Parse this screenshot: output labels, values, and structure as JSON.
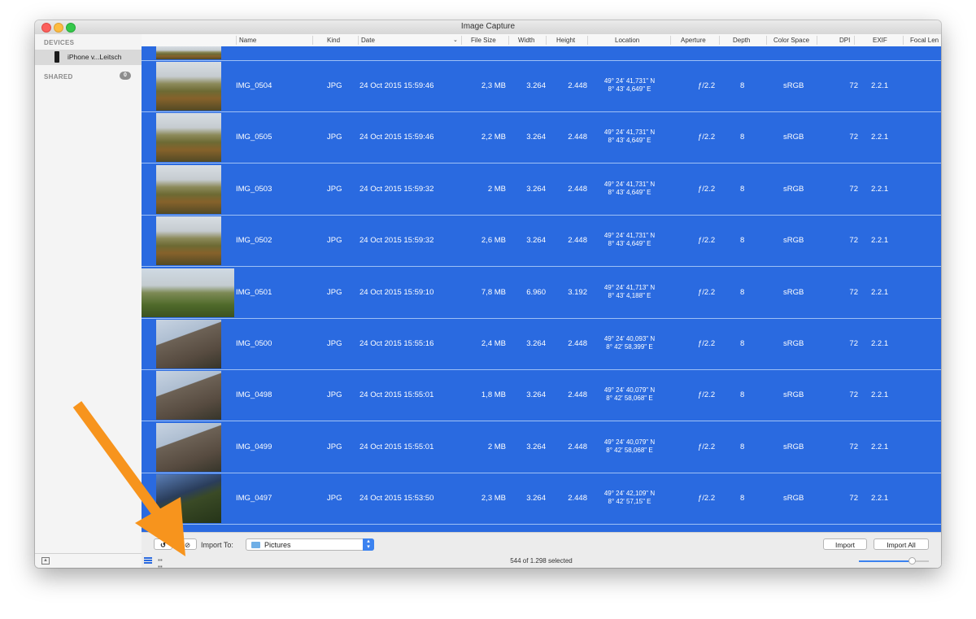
{
  "window": {
    "title": "Image Capture"
  },
  "sidebar": {
    "devices_header": "DEVICES",
    "device_label": "iPhone v...Leitsch",
    "shared_header": "SHARED",
    "shared_count": "0"
  },
  "columns": [
    "Name",
    "Kind",
    "Date",
    "File Size",
    "Width",
    "Height",
    "Location",
    "Aperture",
    "Depth",
    "Color Space",
    "DPI",
    "EXIF",
    "Focal Len"
  ],
  "rows": [
    {
      "name": "IMG_0504",
      "kind": "JPG",
      "date": "24 Oct 2015 15:59:46",
      "size": "2,3 MB",
      "width": "3.264",
      "height": "2.448",
      "loc1": "49° 24' 41,731\" N",
      "loc2": "8° 43' 4,649\" E",
      "aperture": "ƒ/2.2",
      "depth": "8",
      "colorspace": "sRGB",
      "dpi": "72",
      "exif": "2.2.1",
      "thumb": "town"
    },
    {
      "name": "IMG_0505",
      "kind": "JPG",
      "date": "24 Oct 2015 15:59:46",
      "size": "2,2 MB",
      "width": "3.264",
      "height": "2.448",
      "loc1": "49° 24' 41,731\" N",
      "loc2": "8° 43' 4,649\" E",
      "aperture": "ƒ/2.2",
      "depth": "8",
      "colorspace": "sRGB",
      "dpi": "72",
      "exif": "2.2.1",
      "thumb": "town"
    },
    {
      "name": "IMG_0503",
      "kind": "JPG",
      "date": "24 Oct 2015 15:59:32",
      "size": "2 MB",
      "width": "3.264",
      "height": "2.448",
      "loc1": "49° 24' 41,731\" N",
      "loc2": "8° 43' 4,649\" E",
      "aperture": "ƒ/2.2",
      "depth": "8",
      "colorspace": "sRGB",
      "dpi": "72",
      "exif": "2.2.1",
      "thumb": "town"
    },
    {
      "name": "IMG_0502",
      "kind": "JPG",
      "date": "24 Oct 2015 15:59:32",
      "size": "2,6 MB",
      "width": "3.264",
      "height": "2.448",
      "loc1": "49° 24' 41,731\" N",
      "loc2": "8° 43' 4,649\" E",
      "aperture": "ƒ/2.2",
      "depth": "8",
      "colorspace": "sRGB",
      "dpi": "72",
      "exif": "2.2.1",
      "thumb": "town"
    },
    {
      "name": "IMG_0501",
      "kind": "JPG",
      "date": "24 Oct 2015 15:59:10",
      "size": "7,8 MB",
      "width": "6.960",
      "height": "3.192",
      "loc1": "49° 24' 41,713\" N",
      "loc2": "8° 43' 4,188\" E",
      "aperture": "ƒ/2.2",
      "depth": "8",
      "colorspace": "sRGB",
      "dpi": "72",
      "exif": "2.2.1",
      "thumb": "pano"
    },
    {
      "name": "IMG_0500",
      "kind": "JPG",
      "date": "24 Oct 2015 15:55:16",
      "size": "2,4 MB",
      "width": "3.264",
      "height": "2.448",
      "loc1": "49° 24' 40,093\" N",
      "loc2": "8° 42' 58,399\" E",
      "aperture": "ƒ/2.2",
      "depth": "8",
      "colorspace": "sRGB",
      "dpi": "72",
      "exif": "2.2.1",
      "thumb": "tower"
    },
    {
      "name": "IMG_0498",
      "kind": "JPG",
      "date": "24 Oct 2015 15:55:01",
      "size": "1,8 MB",
      "width": "3.264",
      "height": "2.448",
      "loc1": "49° 24' 40,079\" N",
      "loc2": "8° 42' 58,068\" E",
      "aperture": "ƒ/2.2",
      "depth": "8",
      "colorspace": "sRGB",
      "dpi": "72",
      "exif": "2.2.1",
      "thumb": "tower"
    },
    {
      "name": "IMG_0499",
      "kind": "JPG",
      "date": "24 Oct 2015 15:55:01",
      "size": "2 MB",
      "width": "3.264",
      "height": "2.448",
      "loc1": "49° 24' 40,079\" N",
      "loc2": "8° 42' 58,068\" E",
      "aperture": "ƒ/2.2",
      "depth": "8",
      "colorspace": "sRGB",
      "dpi": "72",
      "exif": "2.2.1",
      "thumb": "tower"
    },
    {
      "name": "IMG_0497",
      "kind": "JPG",
      "date": "24 Oct 2015 15:53:50",
      "size": "2,3 MB",
      "width": "3.264",
      "height": "2.448",
      "loc1": "49° 24' 42,109\" N",
      "loc2": "8° 42' 57,15\" E",
      "aperture": "ƒ/2.2",
      "depth": "8",
      "colorspace": "sRGB",
      "dpi": "72",
      "exif": "2.2.1",
      "thumb": "dark"
    }
  ],
  "toolbar": {
    "rotate_glyph": "↺",
    "delete_glyph": "⊘",
    "import_to_label": "Import To:",
    "destination": "Pictures",
    "import_label": "Import",
    "import_all_label": "Import All"
  },
  "status": {
    "selected_text": "544 of 1.298 selected",
    "thumbnail_size": 0.75
  },
  "colors": {
    "selection_blue": "#2a6ae0",
    "annotation_arrow": "#f7941d"
  }
}
